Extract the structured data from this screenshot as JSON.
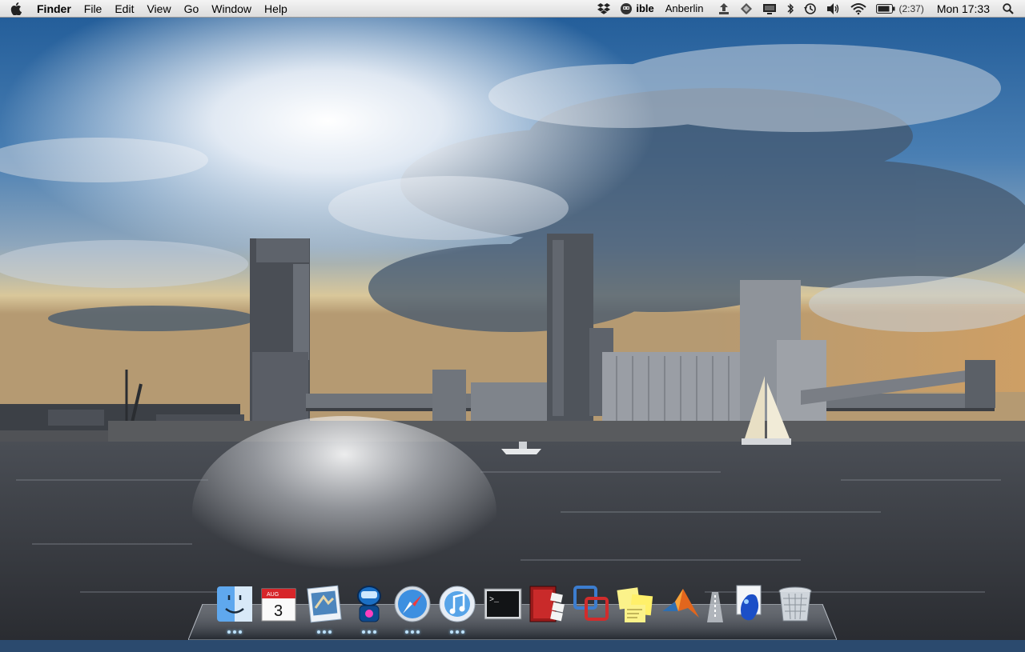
{
  "menubar": {
    "apple_icon": "apple-logo-icon",
    "app_name": "Finder",
    "menus": [
      "File",
      "Edit",
      "View",
      "Go",
      "Window",
      "Help"
    ],
    "status_items": {
      "dropbox_icon": "dropbox-icon",
      "now_playing_icon": "robot-icon",
      "now_playing_prefix": "ible",
      "now_playing_artist": "Anberlin",
      "network_icon": "upload-icon",
      "sync_icon": "diamond-icon",
      "display_icon": "display-icon",
      "bluetooth_icon": "bluetooth-icon",
      "time_machine_icon": "time-machine-icon",
      "volume_icon": "volume-icon",
      "wifi_icon": "wifi-icon",
      "battery_icon": "battery-icon",
      "battery_time": "(2:37)",
      "clock": "Mon 17:33",
      "spotlight_icon": "spotlight-icon"
    }
  },
  "dock": {
    "items": [
      {
        "name": "finder",
        "running": true
      },
      {
        "name": "ical",
        "month": "AUG",
        "day": "3",
        "running": false
      },
      {
        "name": "mail",
        "running": true
      },
      {
        "name": "robot-app",
        "running": true
      },
      {
        "name": "safari",
        "running": true
      },
      {
        "name": "itunes",
        "running": true
      },
      {
        "name": "terminal",
        "prompt": ">_",
        "running": false
      },
      {
        "name": "photo-booth",
        "running": false
      },
      {
        "name": "parallels",
        "running": false
      },
      {
        "name": "stickies",
        "running": false
      },
      {
        "name": "matlab",
        "running": false
      },
      {
        "name": "applications-stack",
        "running": false
      },
      {
        "name": "document-stack",
        "running": false
      },
      {
        "name": "trash",
        "running": false
      }
    ]
  },
  "colors": {
    "menubar_top": "#f4f4f4",
    "menubar_bottom": "#dcdcdc",
    "sky": "#2f6fa8",
    "water": "#3b3f45"
  }
}
